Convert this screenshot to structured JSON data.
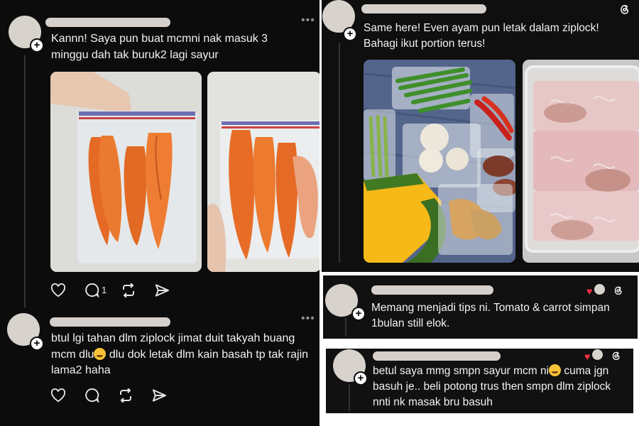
{
  "posts": {
    "left_1": {
      "text": "Kannn! Saya pun buat mcmni nak masuk 3 minggu dah tak buruk2 lagi sayur",
      "actions": {
        "like_icon": "heart-icon",
        "reply_icon": "comment-icon",
        "reply_count": "1",
        "repost_icon": "repost-icon",
        "share_icon": "send-icon"
      }
    },
    "left_2": {
      "text_part1": "btul lgi tahan dlm ziplock jimat duit takyah buang mcm dlu",
      "text_part2": " dlu dok letak dlm kain basah tp tak rajin lama2 haha",
      "emoji": "grinning-sweat-emoji"
    },
    "right_1": {
      "text": "Same here! Even ayam pun letak dalam ziplock! Bahagi ikut portion terus!"
    },
    "right_2": {
      "text": "Memang menjadi tips ni. Tomato & carrot simpan 1bulan still elok."
    },
    "right_3": {
      "text_part1": "betul saya mmg smpn sayur mcm ni",
      "text_part2": " cuma jgn basuh je.. beli potong trus then smpn dlm ziplock nnti nk masak bru basuh",
      "emoji": "grimacing-emoji"
    }
  },
  "colors": {
    "background": "#0c0c0c",
    "text": "#f2f2f2",
    "muted": "#8d8d8d",
    "heart": "#ff3040",
    "carrot": "#e9722a"
  }
}
